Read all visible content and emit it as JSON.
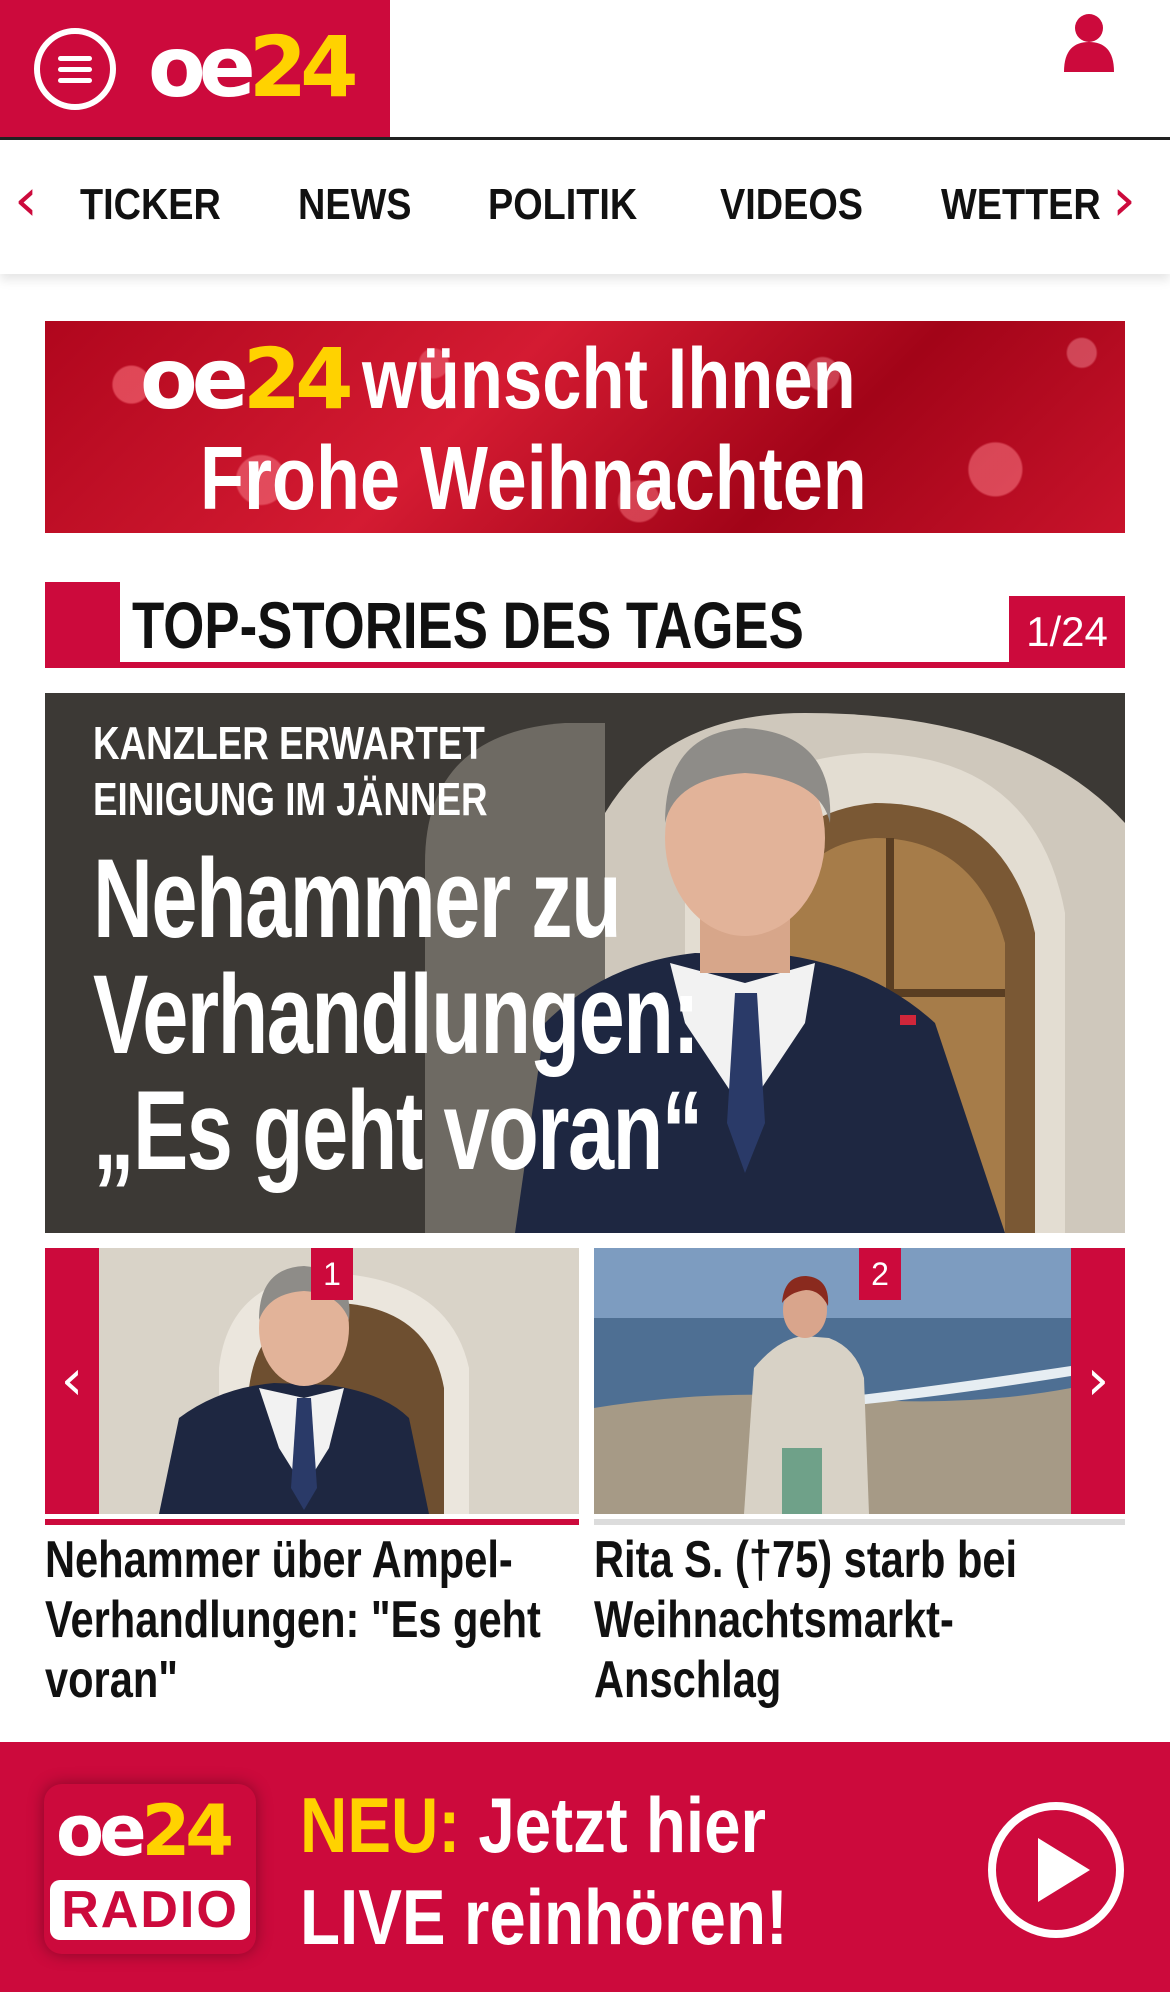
{
  "header": {
    "logo_oe": "oe",
    "logo_num": "24",
    "menu_icon": "hamburger-icon",
    "user_icon": "user-icon",
    "brand_color": "#cc0a3c",
    "accent_color": "#ffd200"
  },
  "nav": {
    "prev_icon": "chevron-left-icon",
    "next_icon": "chevron-right-icon",
    "items": [
      {
        "label": "TICKER"
      },
      {
        "label": "NEWS"
      },
      {
        "label": "POLITIK"
      },
      {
        "label": "VIDEOS"
      },
      {
        "label": "WETTER"
      }
    ]
  },
  "xmas_banner": {
    "logo_oe": "oe",
    "logo_num": "24",
    "line1": "wünscht Ihnen",
    "line2": "Frohe Weihnachten"
  },
  "top_stories": {
    "title": "TOP-STORIES DES TAGES",
    "counter": "1/24"
  },
  "hero": {
    "kicker": "KANZLER ERWARTET\nEINIGUNG IM JÄNNER",
    "headline": "Nehammer zu\nVerhandlungen:\n„Es geht voran“"
  },
  "carousel": {
    "prev_label": "‹",
    "next_label": "›",
    "items": [
      {
        "number": "1",
        "caption": "Nehammer über Ampel-\nVerhandlungen: \"Es geht\nvoran\""
      },
      {
        "number": "2",
        "caption": "Rita S. (†75) starb bei\nWeihnachtsmarkt-Anschlag"
      }
    ]
  },
  "radio_banner": {
    "logo_oe": "oe",
    "logo_num": "24",
    "logo_radio": "RADIO",
    "highlight": "NEU:",
    "line1_rest": " Jetzt hier",
    "line2": "LIVE reinhören!",
    "play_icon": "play-icon"
  }
}
